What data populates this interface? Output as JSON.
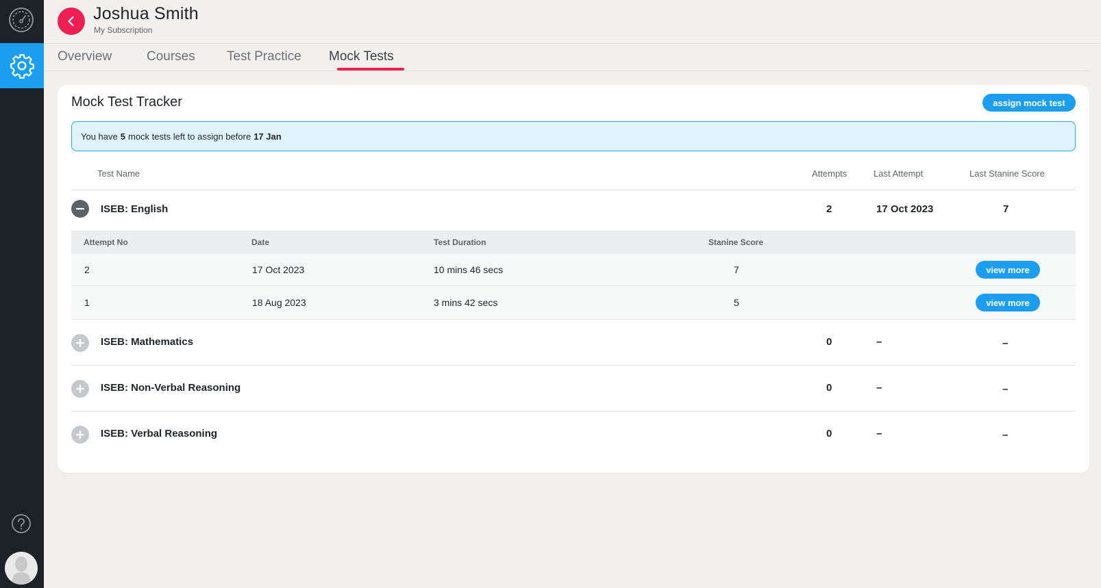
{
  "user": {
    "name": "Joshua Smith",
    "subtitle": "My Subscription"
  },
  "tabs": [
    "Overview",
    "Courses",
    "Test Practice",
    "Mock Tests"
  ],
  "active_tab": "Mock Tests",
  "card": {
    "title": "Mock Test Tracker",
    "assign_label": "assign mock test",
    "banner": {
      "prefix": "You have",
      "count": "5",
      "middle": "mock tests left to assign before",
      "date": "17 Jan"
    }
  },
  "columns": {
    "name": "Test Name",
    "attempts": "Attempts",
    "last_attempt": "Last Attempt",
    "last_score": "Last Stanine Score"
  },
  "tests": [
    {
      "name": "ISEB: English",
      "attempts": "2",
      "last_attempt": "17 Oct 2023",
      "last_score": "7",
      "expanded": true
    },
    {
      "name": "ISEB: Mathematics",
      "attempts": "0",
      "last_attempt": "–",
      "last_score": "–",
      "expanded": false
    },
    {
      "name": "ISEB: Non-Verbal Reasoning",
      "attempts": "0",
      "last_attempt": "–",
      "last_score": "–",
      "expanded": false
    },
    {
      "name": "ISEB: Verbal Reasoning",
      "attempts": "0",
      "last_attempt": "–",
      "last_score": "–",
      "expanded": false
    }
  ],
  "attempt_columns": {
    "no": "Attempt No",
    "date": "Date",
    "duration": "Test Duration",
    "score": "Stanine Score"
  },
  "attempts": [
    {
      "no": "2",
      "date": "17 Oct 2023",
      "duration": "10 mins 46 secs",
      "score": "7",
      "action": "view more"
    },
    {
      "no": "1",
      "date": "18 Aug 2023",
      "duration": "3 mins 42 secs",
      "score": "5",
      "action": "view more"
    }
  ],
  "colors": {
    "sidebar": "#1d2229",
    "accent_blue": "#1b9ef0",
    "accent_red": "#ee1f52",
    "background": "#f1f0ee"
  },
  "icons": [
    "speedometer-icon",
    "gear-icon",
    "help-icon",
    "avatar",
    "chevron-left-icon",
    "minus-icon",
    "plus-icon"
  ]
}
